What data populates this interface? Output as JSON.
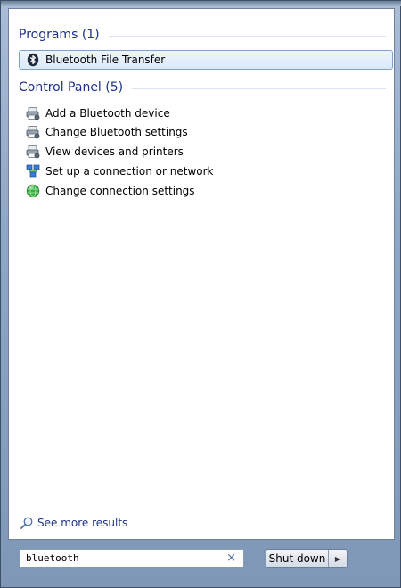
{
  "groups": [
    {
      "title": "Programs (1)",
      "items": [
        {
          "label": "Bluetooth File Transfer",
          "icon": "bluetooth-icon"
        }
      ]
    },
    {
      "title": "Control Panel (5)",
      "items": [
        {
          "label": "Add a Bluetooth device",
          "icon": "devices-printer-icon"
        },
        {
          "label": "Change Bluetooth settings",
          "icon": "devices-printer-icon"
        },
        {
          "label": "View devices and printers",
          "icon": "devices-printer-icon"
        },
        {
          "label": "Set up a connection or network",
          "icon": "network-icon"
        },
        {
          "label": "Change connection settings",
          "icon": "globe-icon"
        }
      ]
    }
  ],
  "see_more": "See more results",
  "search": {
    "value": "bluetooth"
  },
  "clear_glyph": "×",
  "shutdown": {
    "label": "Shut down",
    "arrow": "▶"
  },
  "colors": {
    "accent": "#1e3287",
    "selection": "#dbe9f8"
  }
}
